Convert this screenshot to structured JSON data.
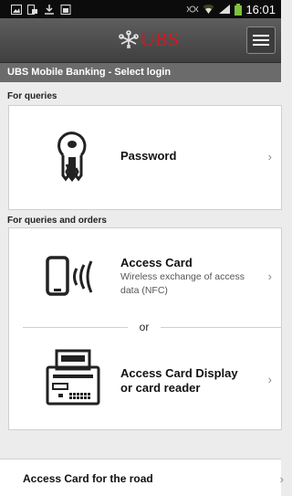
{
  "status_bar": {
    "time": "16:01"
  },
  "app_bar": {
    "logo_text": "UBS"
  },
  "title_bar": {
    "title": "UBS Mobile Banking - Select login"
  },
  "sections": [
    {
      "heading": "For queries",
      "items": [
        {
          "label": "Password",
          "chevron": "›"
        }
      ]
    },
    {
      "heading": "For queries and orders",
      "items": [
        {
          "label": "Access Card",
          "description": "Wireless exchange of access data (NFC)",
          "chevron": "›"
        },
        {
          "label": "Access Card Display or card reader",
          "chevron": "›"
        }
      ],
      "separator_text": "or"
    }
  ],
  "bottom_item": {
    "label": "Access Card for the road",
    "chevron": "›"
  },
  "colors": {
    "accent": "#d8161e",
    "appbar": "#4a4a4a",
    "titlebar": "#6b6b6b"
  }
}
